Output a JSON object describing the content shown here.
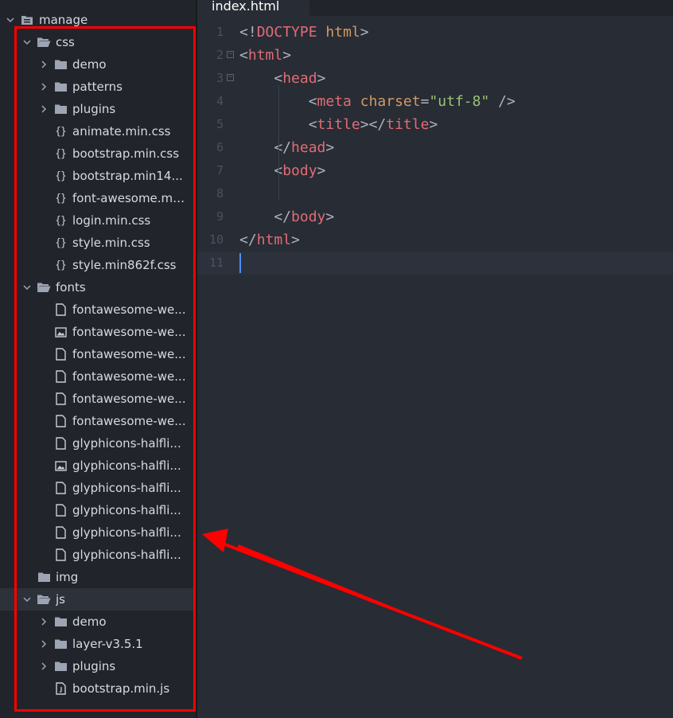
{
  "sidebar": {
    "root": {
      "label": "manage",
      "expanded": true
    },
    "items": [
      {
        "label": "css",
        "type": "folder",
        "expanded": true,
        "icon": "folder-open-icon"
      },
      {
        "label": "demo",
        "type": "folder",
        "expanded": false,
        "icon": "folder-icon"
      },
      {
        "label": "patterns",
        "type": "folder",
        "expanded": false,
        "icon": "folder-icon"
      },
      {
        "label": "plugins",
        "type": "folder",
        "expanded": false,
        "icon": "folder-icon"
      },
      {
        "label": "animate.min.css",
        "type": "file",
        "icon": "css-file-icon"
      },
      {
        "label": "bootstrap.min.css",
        "type": "file",
        "icon": "css-file-icon"
      },
      {
        "label": "bootstrap.min14...",
        "type": "file",
        "icon": "css-file-icon"
      },
      {
        "label": "font-awesome.mi...",
        "type": "file",
        "icon": "css-file-icon"
      },
      {
        "label": "login.min.css",
        "type": "file",
        "icon": "css-file-icon"
      },
      {
        "label": "style.min.css",
        "type": "file",
        "icon": "css-file-icon"
      },
      {
        "label": "style.min862f.css",
        "type": "file",
        "icon": "css-file-icon"
      },
      {
        "label": "fonts",
        "type": "folder",
        "expanded": true,
        "icon": "folder-open-icon"
      },
      {
        "label": "fontawesome-we...",
        "type": "file",
        "icon": "file-icon"
      },
      {
        "label": "fontawesome-we...",
        "type": "file",
        "icon": "image-file-icon"
      },
      {
        "label": "fontawesome-we...",
        "type": "file",
        "icon": "file-icon"
      },
      {
        "label": "fontawesome-we...",
        "type": "file",
        "icon": "file-icon"
      },
      {
        "label": "fontawesome-we...",
        "type": "file",
        "icon": "file-icon"
      },
      {
        "label": "fontawesome-we...",
        "type": "file",
        "icon": "file-icon"
      },
      {
        "label": "glyphicons-halfli...",
        "type": "file",
        "icon": "file-icon"
      },
      {
        "label": "glyphicons-halfli...",
        "type": "file",
        "icon": "image-file-icon"
      },
      {
        "label": "glyphicons-halfli...",
        "type": "file",
        "icon": "file-icon"
      },
      {
        "label": "glyphicons-halfli...",
        "type": "file",
        "icon": "file-icon"
      },
      {
        "label": "glyphicons-halfli...",
        "type": "file",
        "icon": "file-icon"
      },
      {
        "label": "glyphicons-halfli...",
        "type": "file",
        "icon": "file-icon"
      },
      {
        "label": "img",
        "type": "folder",
        "icon": "folder-icon"
      },
      {
        "label": "js",
        "type": "folder",
        "expanded": true,
        "selected": true,
        "icon": "folder-open-icon"
      },
      {
        "label": "demo",
        "type": "folder",
        "expanded": false,
        "icon": "folder-icon"
      },
      {
        "label": "layer-v3.5.1",
        "type": "folder",
        "expanded": false,
        "icon": "folder-icon"
      },
      {
        "label": "plugins",
        "type": "folder",
        "expanded": false,
        "icon": "folder-icon"
      },
      {
        "label": "bootstrap.min.js",
        "type": "file",
        "icon": "js-file-icon"
      }
    ]
  },
  "editor": {
    "tab_label": "index.html",
    "active_line": 11,
    "lines": [
      {
        "n": "1",
        "tokens": [
          [
            "p",
            "<!"
          ],
          [
            "t",
            "DOCTYPE"
          ],
          [
            "p",
            " "
          ],
          [
            "a",
            "html"
          ],
          [
            "p",
            ">"
          ]
        ]
      },
      {
        "n": "2",
        "fold": true,
        "tokens": [
          [
            "p",
            "<"
          ],
          [
            "t",
            "html"
          ],
          [
            "p",
            ">"
          ]
        ]
      },
      {
        "n": "3",
        "fold": true,
        "tokens": [
          [
            "p",
            "    <"
          ],
          [
            "t",
            "head"
          ],
          [
            "p",
            ">"
          ]
        ]
      },
      {
        "n": "4",
        "tokens": [
          [
            "p",
            "        <"
          ],
          [
            "t",
            "meta"
          ],
          [
            "p",
            " "
          ],
          [
            "a",
            "charset"
          ],
          [
            "p",
            "="
          ],
          [
            "s",
            "\"utf-8\""
          ],
          [
            "p",
            " />"
          ]
        ]
      },
      {
        "n": "5",
        "tokens": [
          [
            "p",
            "        <"
          ],
          [
            "t",
            "title"
          ],
          [
            "p",
            "></"
          ],
          [
            "t",
            "title"
          ],
          [
            "p",
            ">"
          ]
        ]
      },
      {
        "n": "6",
        "tokens": [
          [
            "p",
            "    </"
          ],
          [
            "t",
            "head"
          ],
          [
            "p",
            ">"
          ]
        ]
      },
      {
        "n": "7",
        "tokens": [
          [
            "p",
            "    <"
          ],
          [
            "t",
            "body"
          ],
          [
            "p",
            ">"
          ]
        ]
      },
      {
        "n": "8",
        "tokens": []
      },
      {
        "n": "9",
        "tokens": [
          [
            "p",
            "    </"
          ],
          [
            "t",
            "body"
          ],
          [
            "p",
            ">"
          ]
        ]
      },
      {
        "n": "10",
        "tokens": [
          [
            "p",
            "</"
          ],
          [
            "t",
            "html"
          ],
          [
            "p",
            ">"
          ]
        ]
      },
      {
        "n": "11",
        "tokens": []
      }
    ]
  },
  "colors": {
    "annotation": "#ff0000",
    "tag": "#e06c75",
    "attribute": "#d19a66",
    "string": "#98c379",
    "punctuation": "#abb2bf",
    "cursor": "#528bff"
  }
}
